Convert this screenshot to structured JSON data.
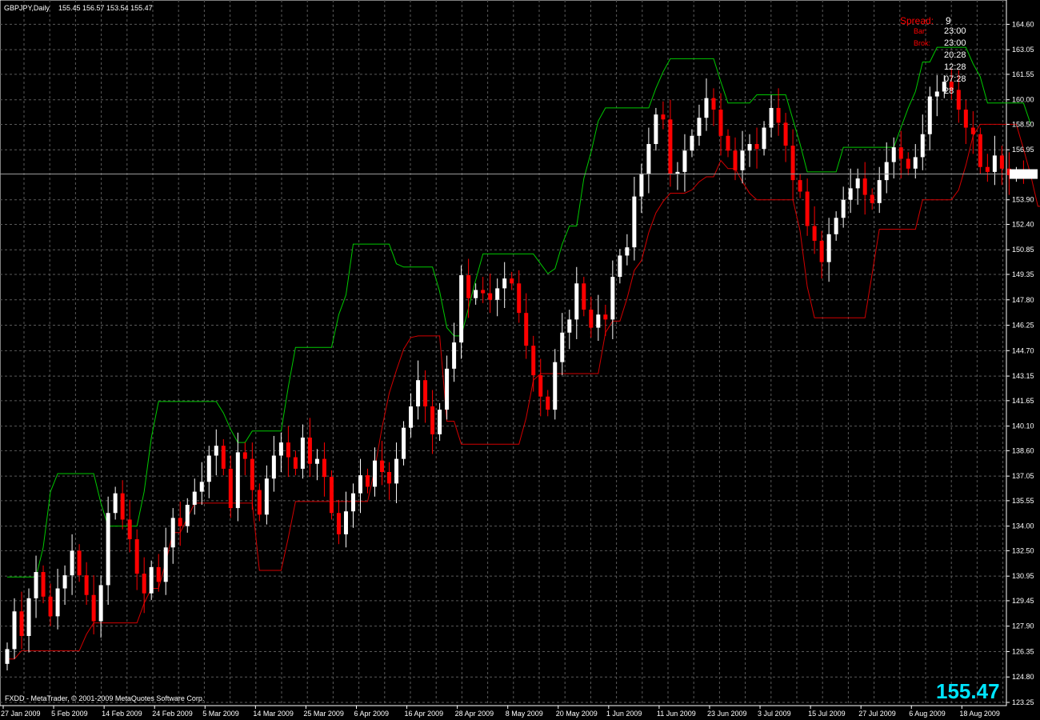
{
  "header": {
    "symbol": "GBPJPY,Daily",
    "ohlc": "155.45 156.57 153.54 155.47"
  },
  "footer": {
    "copyright": "FXDD - MetaTrader, © 2001-2009 MetaQuotes Software Corp.",
    "big_price": "155.47"
  },
  "info_panel": {
    "spread_label": "Spread:",
    "spread_value": "9",
    "rows": [
      {
        "label": "Bar:",
        "value": "23:00"
      },
      {
        "label": "Brok:",
        "value": "23:00"
      },
      {
        "label": "",
        "value": "20:28"
      },
      {
        "label": "",
        "value": "12:28"
      },
      {
        "label": "",
        "value": "07:28"
      },
      {
        "label": "",
        "value": "28"
      }
    ]
  },
  "colors": {
    "background": "#000000",
    "grid": "#5a5a5a",
    "bull_candle": "#ffffff",
    "bear_candle": "#ff0000",
    "upper_channel": "#00c800",
    "lower_channel": "#d20000",
    "price_line": "#9a9a9a",
    "big_price": "#00e5ff",
    "spread_label": "#ff0000",
    "info_label": "#ff0000",
    "info_value": "#ffffff"
  },
  "chart_data": {
    "type": "candlestick",
    "symbol": "GBPJPY",
    "timeframe": "Daily",
    "ylim": [
      123.25,
      165.4
    ],
    "last_price": 155.47,
    "grid": true,
    "y_ticks": [
      "164.60",
      "163.05",
      "161.55",
      "160.00",
      "158.50",
      "156.95",
      "155.47",
      "153.90",
      "152.40",
      "150.85",
      "149.35",
      "147.80",
      "146.25",
      "144.70",
      "143.15",
      "141.65",
      "140.10",
      "138.60",
      "137.05",
      "135.55",
      "134.00",
      "132.50",
      "130.95",
      "129.45",
      "127.90",
      "126.35",
      "124.80",
      "123.25"
    ],
    "x_ticks": [
      {
        "label": "27 Jan 2009",
        "i": 0
      },
      {
        "label": "5 Feb 2009",
        "i": 7
      },
      {
        "label": "14 Feb 2009",
        "i": 14
      },
      {
        "label": "24 Feb 2009",
        "i": 21
      },
      {
        "label": "5 Mar 2009",
        "i": 28
      },
      {
        "label": "14 Mar 2009",
        "i": 35
      },
      {
        "label": "25 Mar 2009",
        "i": 42
      },
      {
        "label": "6 Apr 2009",
        "i": 49
      },
      {
        "label": "16 Apr 2009",
        "i": 56
      },
      {
        "label": "28 Apr 2009",
        "i": 63
      },
      {
        "label": "8 May 2009",
        "i": 70
      },
      {
        "label": "20 May 2009",
        "i": 77
      },
      {
        "label": "1 Jun 2009",
        "i": 84
      },
      {
        "label": "11 Jun 2009",
        "i": 91
      },
      {
        "label": "23 Jun 2009",
        "i": 98
      },
      {
        "label": "3 Jul 2009",
        "i": 105
      },
      {
        "label": "15 Jul 2009",
        "i": 112
      },
      {
        "label": "27 Jul 2009",
        "i": 119
      },
      {
        "label": "6 Aug 2009",
        "i": 126
      },
      {
        "label": "18 Aug 2009",
        "i": 133
      }
    ],
    "close": [
      126.5,
      128.8,
      127.3,
      129.6,
      131.2,
      129.7,
      128.5,
      130.2,
      131.0,
      132.5,
      131.0,
      129.8,
      128.2,
      130.4,
      134.8,
      136.0,
      134.4,
      133.2,
      131.1,
      129.9,
      131.5,
      130.6,
      132.7,
      134.5,
      134.0,
      135.3,
      136.1,
      136.7,
      138.3,
      138.9,
      137.5,
      135.1,
      138.5,
      138.1,
      136.2,
      134.7,
      136.9,
      138.3,
      139.1,
      138.2,
      137.5,
      139.4,
      137.8,
      138.1,
      137.0,
      134.8,
      133.5,
      134.9,
      136.0,
      137.1,
      136.4,
      138.0,
      137.3,
      136.6,
      138.1,
      140.0,
      141.3,
      142.9,
      141.3,
      139.6,
      141.1,
      143.6,
      145.2,
      149.3,
      147.9,
      148.4,
      148.2,
      147.8,
      148.5,
      149.1,
      148.8,
      147.0,
      145.0,
      143.2,
      141.9,
      141.1,
      144.0,
      145.8,
      146.6,
      148.8,
      147.2,
      146.1,
      146.9,
      146.6,
      149.2,
      150.5,
      151.0,
      154.1,
      155.5,
      157.3,
      159.1,
      158.8,
      155.5,
      155.6,
      156.9,
      157.8,
      158.9,
      160.1,
      159.4,
      157.8,
      156.9,
      155.7,
      156.9,
      157.3,
      157.0,
      158.3,
      159.5,
      158.6,
      157.2,
      155.1,
      154.4,
      152.3,
      151.4,
      150.1,
      151.8,
      152.8,
      153.9,
      154.6,
      155.2,
      154.2,
      153.7,
      155.1,
      156.2,
      157.1,
      156.4,
      155.8,
      156.5,
      157.9,
      160.2,
      160.5,
      161.1,
      160.6,
      159.4,
      158.3,
      157.9,
      155.9,
      155.6,
      156.6,
      155.8,
      155.4,
      155.5,
      155.47
    ],
    "upper_channel": [
      130.9,
      130.9,
      130.9,
      130.9,
      130.9,
      132.7,
      136.1,
      137.2,
      137.2,
      137.2,
      137.2,
      137.2,
      137.2,
      135.4,
      134.0,
      134.0,
      134.0,
      134.0,
      134.0,
      136.1,
      139.4,
      141.6,
      141.6,
      141.6,
      141.6,
      141.6,
      141.6,
      141.6,
      141.6,
      141.6,
      140.9,
      139.9,
      139.1,
      139.1,
      139.8,
      139.8,
      139.8,
      139.8,
      139.8,
      142.5,
      144.9,
      144.9,
      144.9,
      144.9,
      144.9,
      144.9,
      146.9,
      148.1,
      151.2,
      151.2,
      151.2,
      151.2,
      151.2,
      151.2,
      150.0,
      149.8,
      149.8,
      149.8,
      149.8,
      149.8,
      148.3,
      146.1,
      145.6,
      145.6,
      147.3,
      149.0,
      150.6,
      150.6,
      150.6,
      150.6,
      150.6,
      150.6,
      150.6,
      150.6,
      150.0,
      149.4,
      149.7,
      151.2,
      152.3,
      152.3,
      155.2,
      156.8,
      158.7,
      159.5,
      159.5,
      159.5,
      159.5,
      159.5,
      159.5,
      159.5,
      160.7,
      161.7,
      162.5,
      162.5,
      162.5,
      162.5,
      162.5,
      162.5,
      162.5,
      161.1,
      159.8,
      159.8,
      159.8,
      159.8,
      160.3,
      160.3,
      160.3,
      160.3,
      160.3,
      158.8,
      157.3,
      155.6,
      155.6,
      155.6,
      155.6,
      155.6,
      157.1,
      157.1,
      157.1,
      157.1,
      157.1,
      157.1,
      157.1,
      157.1,
      158.3,
      159.5,
      160.5,
      162.3,
      162.3,
      163.2,
      163.2,
      163.2,
      163.2,
      163.2,
      162.2,
      161.4,
      159.8,
      159.8,
      159.8,
      159.8,
      159.8,
      159.8,
      158.5
    ],
    "lower_channel": [
      125.9,
      125.9,
      126.4,
      126.4,
      126.4,
      126.4,
      126.4,
      126.4,
      126.4,
      126.4,
      126.4,
      127.4,
      128.1,
      128.1,
      128.1,
      128.1,
      128.1,
      128.1,
      128.1,
      129.3,
      130.2,
      130.2,
      131.8,
      133.6,
      133.6,
      134.5,
      135.4,
      135.4,
      135.4,
      135.4,
      135.4,
      135.4,
      135.4,
      135.4,
      135.4,
      131.3,
      131.3,
      131.3,
      131.3,
      133.3,
      135.5,
      135.5,
      135.5,
      135.5,
      135.5,
      135.5,
      135.5,
      135.5,
      135.5,
      135.5,
      135.5,
      137.5,
      140.0,
      142.1,
      143.5,
      144.8,
      145.5,
      145.6,
      145.6,
      145.6,
      145.6,
      140.4,
      140.4,
      139.0,
      139.0,
      139.0,
      139.0,
      139.0,
      139.0,
      139.0,
      139.0,
      139.0,
      140.6,
      142.9,
      143.3,
      143.3,
      143.3,
      143.3,
      143.3,
      143.3,
      143.3,
      143.3,
      143.3,
      145.8,
      146.5,
      146.5,
      147.9,
      149.6,
      150.2,
      151.9,
      153.1,
      153.8,
      154.3,
      154.3,
      154.3,
      154.5,
      155.0,
      155.3,
      155.3,
      156.3,
      155.8,
      155.8,
      155.0,
      154.3,
      153.9,
      153.9,
      153.9,
      153.9,
      153.9,
      153.9,
      152.0,
      148.6,
      146.7,
      146.7,
      146.7,
      146.7,
      146.7,
      146.7,
      146.7,
      146.7,
      149.4,
      152.1,
      152.1,
      152.1,
      152.1,
      152.1,
      152.1,
      153.9,
      153.9,
      153.9,
      153.9,
      153.9,
      154.5,
      156.0,
      157.8,
      158.5,
      158.5,
      158.5,
      158.5,
      158.5,
      158.5,
      157.0,
      155.4,
      153.5,
      153.5
    ]
  }
}
